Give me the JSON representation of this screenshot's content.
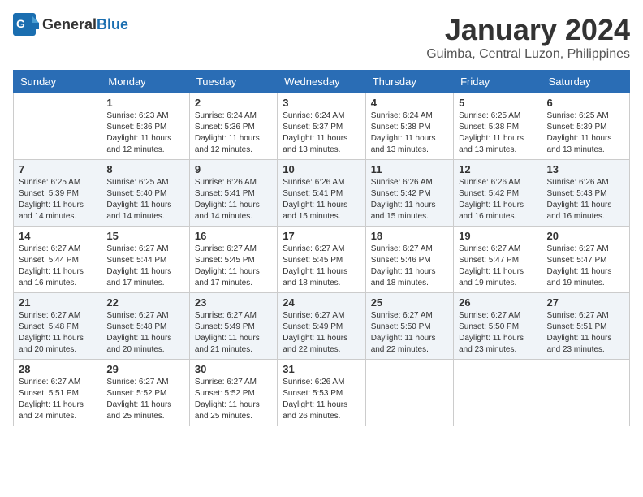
{
  "logo": {
    "general": "General",
    "blue": "Blue"
  },
  "title": "January 2024",
  "location": "Guimba, Central Luzon, Philippines",
  "weekdays": [
    "Sunday",
    "Monday",
    "Tuesday",
    "Wednesday",
    "Thursday",
    "Friday",
    "Saturday"
  ],
  "weeks": [
    [
      {
        "day": "",
        "sunrise": "",
        "sunset": "",
        "daylight": ""
      },
      {
        "day": "1",
        "sunrise": "Sunrise: 6:23 AM",
        "sunset": "Sunset: 5:36 PM",
        "daylight": "Daylight: 11 hours and 12 minutes."
      },
      {
        "day": "2",
        "sunrise": "Sunrise: 6:24 AM",
        "sunset": "Sunset: 5:36 PM",
        "daylight": "Daylight: 11 hours and 12 minutes."
      },
      {
        "day": "3",
        "sunrise": "Sunrise: 6:24 AM",
        "sunset": "Sunset: 5:37 PM",
        "daylight": "Daylight: 11 hours and 13 minutes."
      },
      {
        "day": "4",
        "sunrise": "Sunrise: 6:24 AM",
        "sunset": "Sunset: 5:38 PM",
        "daylight": "Daylight: 11 hours and 13 minutes."
      },
      {
        "day": "5",
        "sunrise": "Sunrise: 6:25 AM",
        "sunset": "Sunset: 5:38 PM",
        "daylight": "Daylight: 11 hours and 13 minutes."
      },
      {
        "day": "6",
        "sunrise": "Sunrise: 6:25 AM",
        "sunset": "Sunset: 5:39 PM",
        "daylight": "Daylight: 11 hours and 13 minutes."
      }
    ],
    [
      {
        "day": "7",
        "sunrise": "Sunrise: 6:25 AM",
        "sunset": "Sunset: 5:39 PM",
        "daylight": "Daylight: 11 hours and 14 minutes."
      },
      {
        "day": "8",
        "sunrise": "Sunrise: 6:25 AM",
        "sunset": "Sunset: 5:40 PM",
        "daylight": "Daylight: 11 hours and 14 minutes."
      },
      {
        "day": "9",
        "sunrise": "Sunrise: 6:26 AM",
        "sunset": "Sunset: 5:41 PM",
        "daylight": "Daylight: 11 hours and 14 minutes."
      },
      {
        "day": "10",
        "sunrise": "Sunrise: 6:26 AM",
        "sunset": "Sunset: 5:41 PM",
        "daylight": "Daylight: 11 hours and 15 minutes."
      },
      {
        "day": "11",
        "sunrise": "Sunrise: 6:26 AM",
        "sunset": "Sunset: 5:42 PM",
        "daylight": "Daylight: 11 hours and 15 minutes."
      },
      {
        "day": "12",
        "sunrise": "Sunrise: 6:26 AM",
        "sunset": "Sunset: 5:42 PM",
        "daylight": "Daylight: 11 hours and 16 minutes."
      },
      {
        "day": "13",
        "sunrise": "Sunrise: 6:26 AM",
        "sunset": "Sunset: 5:43 PM",
        "daylight": "Daylight: 11 hours and 16 minutes."
      }
    ],
    [
      {
        "day": "14",
        "sunrise": "Sunrise: 6:27 AM",
        "sunset": "Sunset: 5:44 PM",
        "daylight": "Daylight: 11 hours and 16 minutes."
      },
      {
        "day": "15",
        "sunrise": "Sunrise: 6:27 AM",
        "sunset": "Sunset: 5:44 PM",
        "daylight": "Daylight: 11 hours and 17 minutes."
      },
      {
        "day": "16",
        "sunrise": "Sunrise: 6:27 AM",
        "sunset": "Sunset: 5:45 PM",
        "daylight": "Daylight: 11 hours and 17 minutes."
      },
      {
        "day": "17",
        "sunrise": "Sunrise: 6:27 AM",
        "sunset": "Sunset: 5:45 PM",
        "daylight": "Daylight: 11 hours and 18 minutes."
      },
      {
        "day": "18",
        "sunrise": "Sunrise: 6:27 AM",
        "sunset": "Sunset: 5:46 PM",
        "daylight": "Daylight: 11 hours and 18 minutes."
      },
      {
        "day": "19",
        "sunrise": "Sunrise: 6:27 AM",
        "sunset": "Sunset: 5:47 PM",
        "daylight": "Daylight: 11 hours and 19 minutes."
      },
      {
        "day": "20",
        "sunrise": "Sunrise: 6:27 AM",
        "sunset": "Sunset: 5:47 PM",
        "daylight": "Daylight: 11 hours and 19 minutes."
      }
    ],
    [
      {
        "day": "21",
        "sunrise": "Sunrise: 6:27 AM",
        "sunset": "Sunset: 5:48 PM",
        "daylight": "Daylight: 11 hours and 20 minutes."
      },
      {
        "day": "22",
        "sunrise": "Sunrise: 6:27 AM",
        "sunset": "Sunset: 5:48 PM",
        "daylight": "Daylight: 11 hours and 20 minutes."
      },
      {
        "day": "23",
        "sunrise": "Sunrise: 6:27 AM",
        "sunset": "Sunset: 5:49 PM",
        "daylight": "Daylight: 11 hours and 21 minutes."
      },
      {
        "day": "24",
        "sunrise": "Sunrise: 6:27 AM",
        "sunset": "Sunset: 5:49 PM",
        "daylight": "Daylight: 11 hours and 22 minutes."
      },
      {
        "day": "25",
        "sunrise": "Sunrise: 6:27 AM",
        "sunset": "Sunset: 5:50 PM",
        "daylight": "Daylight: 11 hours and 22 minutes."
      },
      {
        "day": "26",
        "sunrise": "Sunrise: 6:27 AM",
        "sunset": "Sunset: 5:50 PM",
        "daylight": "Daylight: 11 hours and 23 minutes."
      },
      {
        "day": "27",
        "sunrise": "Sunrise: 6:27 AM",
        "sunset": "Sunset: 5:51 PM",
        "daylight": "Daylight: 11 hours and 23 minutes."
      }
    ],
    [
      {
        "day": "28",
        "sunrise": "Sunrise: 6:27 AM",
        "sunset": "Sunset: 5:51 PM",
        "daylight": "Daylight: 11 hours and 24 minutes."
      },
      {
        "day": "29",
        "sunrise": "Sunrise: 6:27 AM",
        "sunset": "Sunset: 5:52 PM",
        "daylight": "Daylight: 11 hours and 25 minutes."
      },
      {
        "day": "30",
        "sunrise": "Sunrise: 6:27 AM",
        "sunset": "Sunset: 5:52 PM",
        "daylight": "Daylight: 11 hours and 25 minutes."
      },
      {
        "day": "31",
        "sunrise": "Sunrise: 6:26 AM",
        "sunset": "Sunset: 5:53 PM",
        "daylight": "Daylight: 11 hours and 26 minutes."
      },
      {
        "day": "",
        "sunrise": "",
        "sunset": "",
        "daylight": ""
      },
      {
        "day": "",
        "sunrise": "",
        "sunset": "",
        "daylight": ""
      },
      {
        "day": "",
        "sunrise": "",
        "sunset": "",
        "daylight": ""
      }
    ]
  ]
}
